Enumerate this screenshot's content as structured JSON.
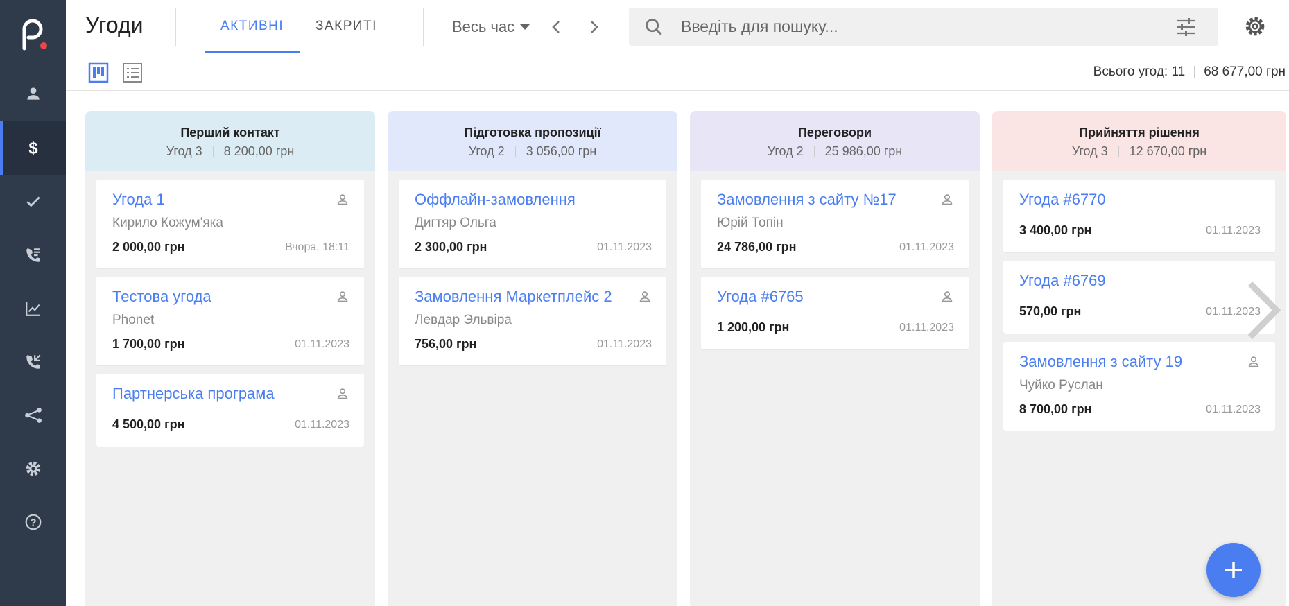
{
  "header": {
    "title": "Угоди",
    "tabs": [
      {
        "label": "АКТИВНІ",
        "active": true
      },
      {
        "label": "ЗАКРИТІ",
        "active": false
      }
    ],
    "period": "Весь час",
    "search_placeholder": "Введіть для пошуку..."
  },
  "toolbar": {
    "total_deals": "Всього угод: 11",
    "total_amount": "68 677,00 грн"
  },
  "sidebar": {
    "items": [
      {
        "icon": "person-icon"
      },
      {
        "icon": "dollar-icon",
        "active": true
      },
      {
        "icon": "check-icon"
      },
      {
        "icon": "phone-list-icon"
      },
      {
        "icon": "chart-icon"
      },
      {
        "icon": "phone-callback-icon"
      },
      {
        "icon": "flow-icon"
      },
      {
        "icon": "gear-icon"
      },
      {
        "icon": "help-icon"
      }
    ]
  },
  "colors": {
    "accent": "#4a7ef0",
    "sidebar_bg": "#2f3a4b",
    "col1_head": "#dcecf5",
    "col2_head": "#e2e8fb",
    "col3_head": "#e8e5f7",
    "col4_head": "#fbe4e4"
  },
  "columns": [
    {
      "title": "Перший контакт",
      "count": "Угод 3",
      "sum": "8 200,00 грн",
      "cards": [
        {
          "title": "Угода 1",
          "contact": "Кирило Кожум'яка",
          "amount": "2 000,00 грн",
          "date": "Вчора, 18:11",
          "has_person": true
        },
        {
          "title": "Тестова угода",
          "contact": "Phonet",
          "amount": "1 700,00 грн",
          "date": "01.11.2023",
          "has_person": true
        },
        {
          "title": "Партнерська програма",
          "contact": "",
          "amount": "4 500,00 грн",
          "date": "01.11.2023",
          "has_person": true
        }
      ]
    },
    {
      "title": "Підготовка пропозиції",
      "count": "Угод 2",
      "sum": "3 056,00 грн",
      "cards": [
        {
          "title": "Оффлайн-замовлення",
          "contact": "Дигтяр Ольга",
          "amount": "2 300,00 грн",
          "date": "01.11.2023",
          "has_person": false
        },
        {
          "title": "Замовлення Маркетплейс 2",
          "contact": "Левдар Эльвіра",
          "amount": "756,00 грн",
          "date": "01.11.2023",
          "has_person": true
        }
      ]
    },
    {
      "title": "Переговори",
      "count": "Угод 2",
      "sum": "25 986,00 грн",
      "cards": [
        {
          "title": "Замовлення з сайту №17",
          "contact": "Юрій Топін",
          "amount": "24 786,00 грн",
          "date": "01.11.2023",
          "has_person": true
        },
        {
          "title": "Угода #6765",
          "contact": "",
          "amount": "1 200,00 грн",
          "date": "01.11.2023",
          "has_person": true
        }
      ]
    },
    {
      "title": "Прийняття рішення",
      "count": "Угод 3",
      "sum": "12 670,00 грн",
      "cards": [
        {
          "title": "Угода #6770",
          "contact": "",
          "amount": "3 400,00 грн",
          "date": "01.11.2023",
          "has_person": false
        },
        {
          "title": "Угода #6769",
          "contact": "",
          "amount": "570,00 грн",
          "date": "01.11.2023",
          "has_person": false
        },
        {
          "title": "Замовлення з сайту 19",
          "contact": "Чуйко Руслан",
          "amount": "8 700,00 грн",
          "date": "01.11.2023",
          "has_person": true
        }
      ]
    }
  ]
}
